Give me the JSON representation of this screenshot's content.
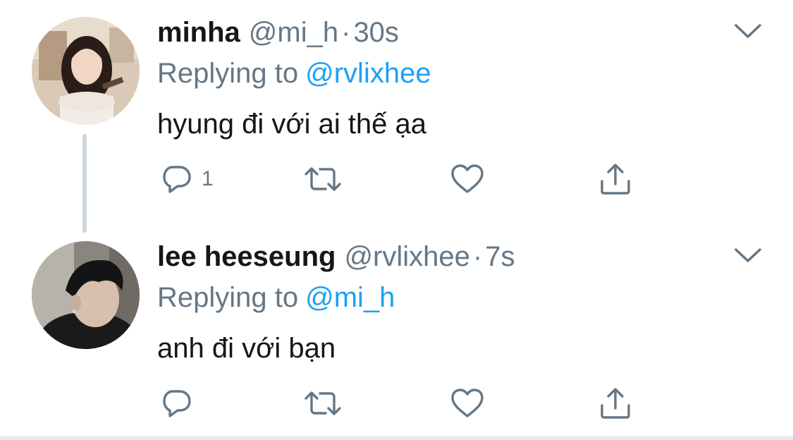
{
  "tweets": [
    {
      "display_name": "minha",
      "handle": "@mi_h",
      "separator": "·",
      "time": "30s",
      "replying_prefix": "Replying to",
      "replying_to": "@rvlixhee",
      "text": "hyung đi với ai thế ạa",
      "reply_count": "1",
      "avatar_icon": "avatar-photo-girl"
    },
    {
      "display_name": "lee heeseung",
      "handle": "@rvlixhee",
      "separator": "·",
      "time": "7s",
      "replying_prefix": "Replying to",
      "replying_to": "@mi_h",
      "text": "anh đi với bạn",
      "reply_count": "",
      "avatar_icon": "avatar-photo-boy"
    }
  ],
  "icons": {
    "reply": "reply-bubble-icon",
    "retweet": "retweet-icon",
    "like": "heart-icon",
    "share": "share-icon",
    "menu": "chevron-down-icon"
  },
  "colors": {
    "link": "#1da1f2",
    "secondary_text": "#657786",
    "primary_text": "#14171a",
    "thread_line": "#ccd6dd",
    "icon": "#657786"
  }
}
